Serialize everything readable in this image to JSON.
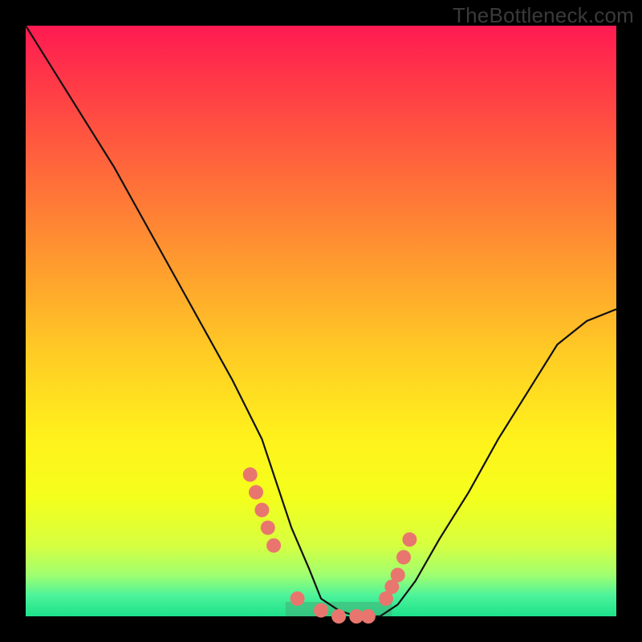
{
  "watermark": "TheBottleneck.com",
  "gradient": {
    "stops": [
      {
        "pos": 0,
        "color": "#ff1a52"
      },
      {
        "pos": 0.1,
        "color": "#ff3a47"
      },
      {
        "pos": 0.25,
        "color": "#ff6a3a"
      },
      {
        "pos": 0.4,
        "color": "#ff9a2f"
      },
      {
        "pos": 0.55,
        "color": "#ffca25"
      },
      {
        "pos": 0.7,
        "color": "#fff21c"
      },
      {
        "pos": 0.8,
        "color": "#f4ff1c"
      },
      {
        "pos": 0.88,
        "color": "#d6ff40"
      },
      {
        "pos": 0.93,
        "color": "#a0ff70"
      },
      {
        "pos": 0.965,
        "color": "#4cf39a"
      },
      {
        "pos": 1.0,
        "color": "#1de28a"
      }
    ]
  },
  "curve_color": "#111111",
  "marker_color": "#e9766e",
  "marker_radius": 9,
  "fit_zone_color": "rgba(70,175,120,0.55)",
  "chart_data": {
    "type": "line",
    "title": "",
    "xlabel": "",
    "ylabel": "",
    "xlim": [
      0,
      100
    ],
    "ylim": [
      0,
      100
    ],
    "series": [
      {
        "name": "bottleneck-curve",
        "x": [
          0,
          5,
          10,
          15,
          20,
          25,
          30,
          35,
          40,
          42,
          45,
          48,
          50,
          53,
          56,
          60,
          63,
          66,
          70,
          75,
          80,
          85,
          90,
          95,
          100
        ],
        "values": [
          100,
          92,
          84,
          76,
          67,
          58,
          49,
          40,
          30,
          24,
          15,
          8,
          3,
          1,
          0,
          0,
          2,
          6,
          13,
          21,
          30,
          38,
          46,
          50,
          52
        ]
      }
    ],
    "markers": {
      "name": "benchmark-points",
      "x": [
        38,
        39,
        40,
        41,
        42,
        46,
        50,
        53,
        56,
        58,
        61,
        62,
        63,
        64,
        65
      ],
      "values": [
        24,
        21,
        18,
        15,
        12,
        3,
        1,
        0,
        0,
        0,
        3,
        5,
        7,
        10,
        13
      ]
    },
    "fit_zone": {
      "x_min": 44,
      "x_max": 62,
      "y": 0
    }
  }
}
